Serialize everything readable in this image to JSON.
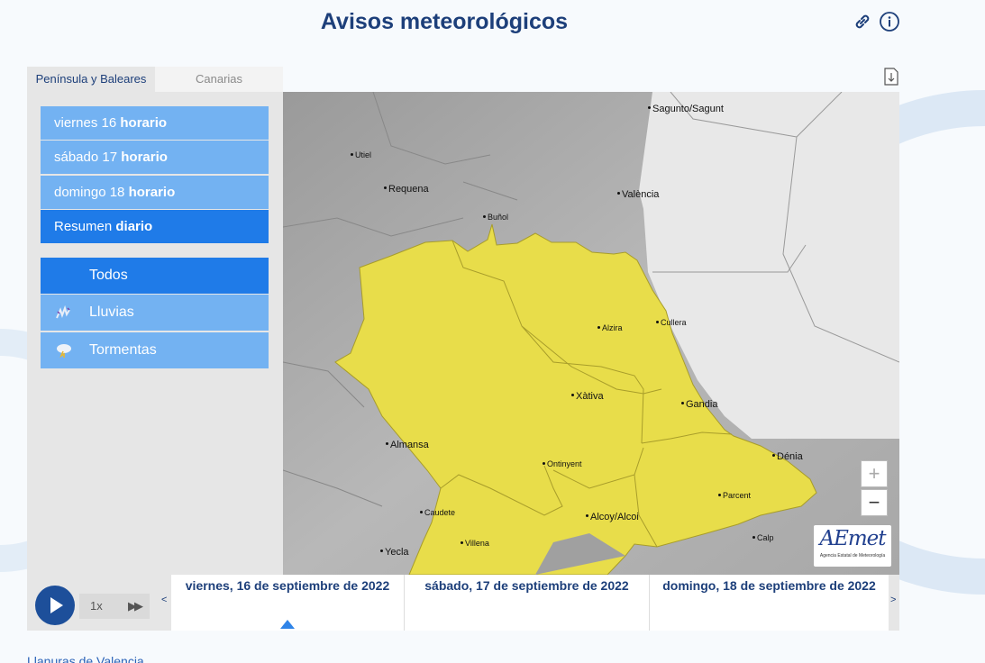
{
  "page": {
    "title": "Avisos meteorológicos",
    "footer_link": "Llanuras de Valencia"
  },
  "header_icons": [
    "link-icon",
    "info-icon"
  ],
  "tabs": [
    {
      "label": "Península y Baleares",
      "active": true
    },
    {
      "label": "Canarias",
      "active": false
    }
  ],
  "days": [
    {
      "day": "viernes 16",
      "mode": "horario",
      "active": false
    },
    {
      "day": "sábado 17",
      "mode": "horario",
      "active": false
    },
    {
      "day": "domingo 18",
      "mode": "horario",
      "active": false
    },
    {
      "day": "Resumen",
      "mode": "diario",
      "active": true
    }
  ],
  "warning_types": [
    {
      "label": "Todos",
      "icon": "",
      "active": true
    },
    {
      "label": "Lluvias",
      "icon": "rain-icon",
      "active": false
    },
    {
      "label": "Tormentas",
      "icon": "storm-icon",
      "active": false
    }
  ],
  "map": {
    "cities": [
      "Sagunto/Sagunt",
      "Utiel",
      "Requena",
      "València",
      "Buñol",
      "Alzira",
      "Cullera",
      "Xàtiva",
      "Gandia",
      "Almansa",
      "Dénia",
      "Ontinyent",
      "Parcent",
      "Caudete",
      "Alcoy/Alcoi",
      "Villena",
      "Calp",
      "Yecla"
    ],
    "zoom_in": "+",
    "zoom_out": "−",
    "logo_text": "AEmet",
    "logo_subtitle": "Agencia Estatal de Meteorología",
    "colors": {
      "warning_yellow": "#e8dd4a",
      "land": "#b5b5b5",
      "sea": "#e8e8e8"
    }
  },
  "player": {
    "speed": "1x",
    "days": [
      "viernes, 16 de septiembre de 2022",
      "sábado, 17 de septiembre de 2022",
      "domingo, 18 de septiembre de 2022"
    ],
    "prev": "<",
    "next": ">"
  }
}
